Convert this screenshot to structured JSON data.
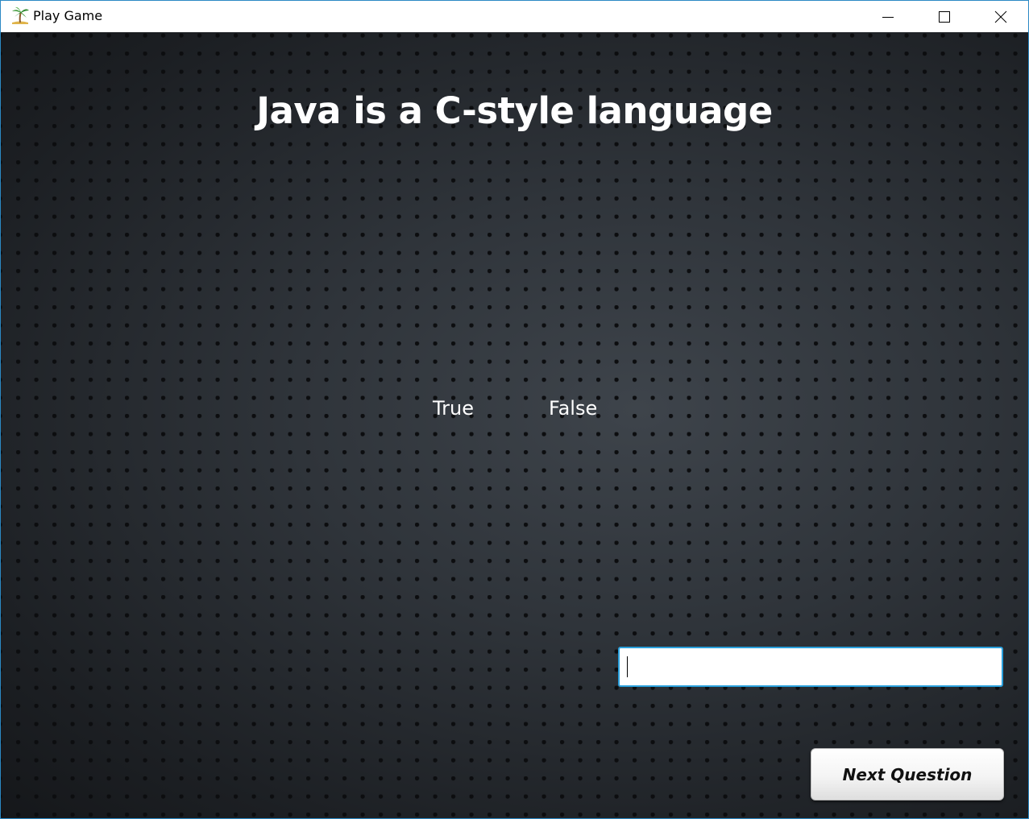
{
  "window": {
    "title": "Play Game",
    "icon": "palm-tree-icon",
    "controls": [
      "minimize-icon",
      "maximize-icon",
      "close-icon"
    ]
  },
  "quiz": {
    "question": "Java is a C-style language",
    "options": [
      {
        "label": "True"
      },
      {
        "label": "False"
      }
    ],
    "answer_input": {
      "value": "",
      "placeholder": ""
    },
    "next_button_label": "Next Question"
  },
  "colors": {
    "input_border": "#2aa0dc",
    "window_border": "#2b89c4",
    "text": "#ffffff"
  }
}
